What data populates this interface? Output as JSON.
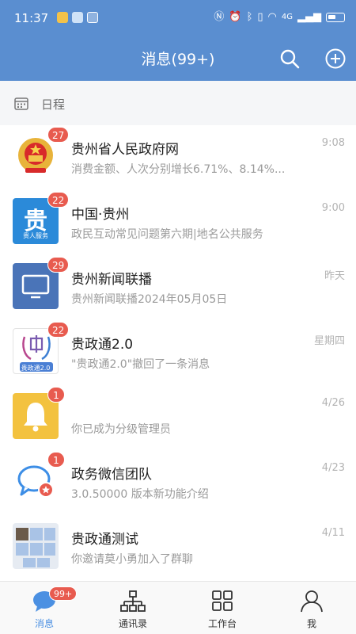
{
  "status_bar": {
    "time": "11:37",
    "network": "4G"
  },
  "header": {
    "title": "消息(99+)"
  },
  "schedule": {
    "label": "日程"
  },
  "conversations": [
    {
      "title": "贵州省人民政府网",
      "subtitle": "消费金额、人次分别增长6.71%、8.14%...",
      "time": "9:08",
      "badge": "27",
      "icon": "emblem-icon"
    },
    {
      "title": "中国·贵州",
      "subtitle": "政民互动常见问题第六期|地名公共服务",
      "time": "9:00",
      "badge": "22",
      "icon": "gui-character-icon",
      "icon_caption": "贵人服务",
      "icon_glyph": "贵"
    },
    {
      "title": "贵州新闻联播",
      "subtitle": "贵州新闻联播2024年05月05日",
      "time": "昨天",
      "badge": "29",
      "icon": "monitor-icon"
    },
    {
      "title": "贵政通2.0",
      "subtitle": "\"贵政通2.0\"撤回了一条消息",
      "time": "星期四",
      "badge": "22",
      "icon": "guizhengtong-logo",
      "icon_caption": "贵政通2.0"
    },
    {
      "title": "",
      "subtitle": "你已成为分级管理员",
      "time": "4/26",
      "badge": "1",
      "icon": "bell-icon"
    },
    {
      "title": "政务微信团队",
      "subtitle": "3.0.50000 版本新功能介绍",
      "time": "4/23",
      "badge": "1",
      "icon": "chat-bubble-icon"
    },
    {
      "title": "贵政通测试",
      "subtitle": "你邀请莫小勇加入了群聊",
      "time": "4/11",
      "badge": "",
      "icon": "group-avatar-icon"
    }
  ],
  "tabbar": [
    {
      "label": "消息",
      "icon": "message-icon",
      "badge": "99+",
      "active": true
    },
    {
      "label": "通讯录",
      "icon": "org-chart-icon",
      "badge": "",
      "active": false
    },
    {
      "label": "工作台",
      "icon": "grid-icon",
      "badge": "",
      "active": false
    },
    {
      "label": "我",
      "icon": "person-icon",
      "badge": "",
      "active": false
    }
  ],
  "colors": {
    "header": "#5a8ed0",
    "badge": "#e85b4f",
    "accent": "#4b90e2"
  }
}
